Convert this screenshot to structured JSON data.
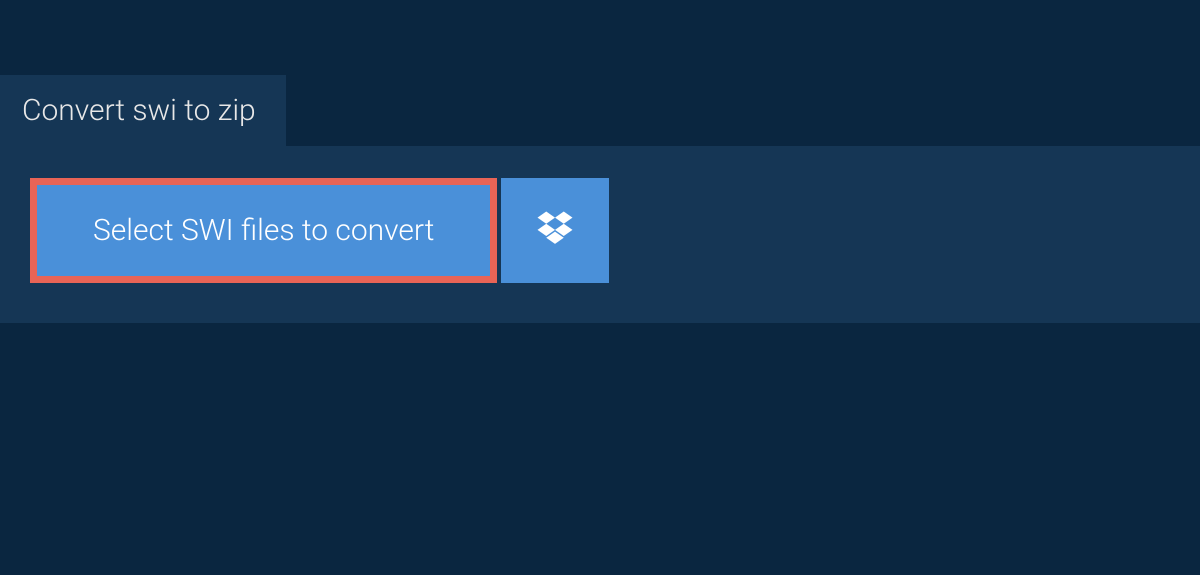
{
  "tab": {
    "label": "Convert swi to zip"
  },
  "actions": {
    "select_files_label": "Select SWI files to convert"
  },
  "colors": {
    "background": "#0a2640",
    "panel": "#153655",
    "button": "#4a90d9",
    "highlight_border": "#e86456"
  }
}
